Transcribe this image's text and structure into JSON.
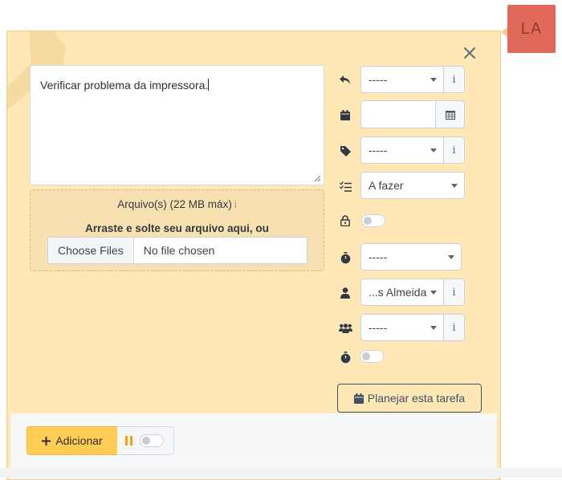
{
  "avatar": {
    "initials": "LA",
    "color": "#e0695a"
  },
  "panel": {
    "background": "#ffe8b5"
  },
  "description": {
    "text": "Verificar problema da impressora."
  },
  "upload": {
    "title": "Arquivo(s) (22 MB máx)",
    "info_icon": "i",
    "drop_hint": "Arraste e solte seu arquivo aqui, ou",
    "choose_label": "Choose Files",
    "status": "No file chosen"
  },
  "fields": {
    "reply_select": "-----",
    "tag_select": "-----",
    "status_select": "A fazer",
    "timer_select": "-----",
    "assignee_select": "...s Almeida",
    "team_select": "-----",
    "info_glyph": "i"
  },
  "actions": {
    "plan_label": "Planejar esta tarefa",
    "add_label": "Adicionar"
  },
  "icons": {
    "close": "close-icon",
    "reply": "reply-icon",
    "calendar": "calendar-icon",
    "tag": "tag-icon",
    "checklist": "checklist-icon",
    "lock": "lock-icon",
    "stopwatch": "stopwatch-icon",
    "user": "user-icon",
    "users": "users-icon",
    "pause": "pause-icon",
    "plus": "plus-icon"
  }
}
